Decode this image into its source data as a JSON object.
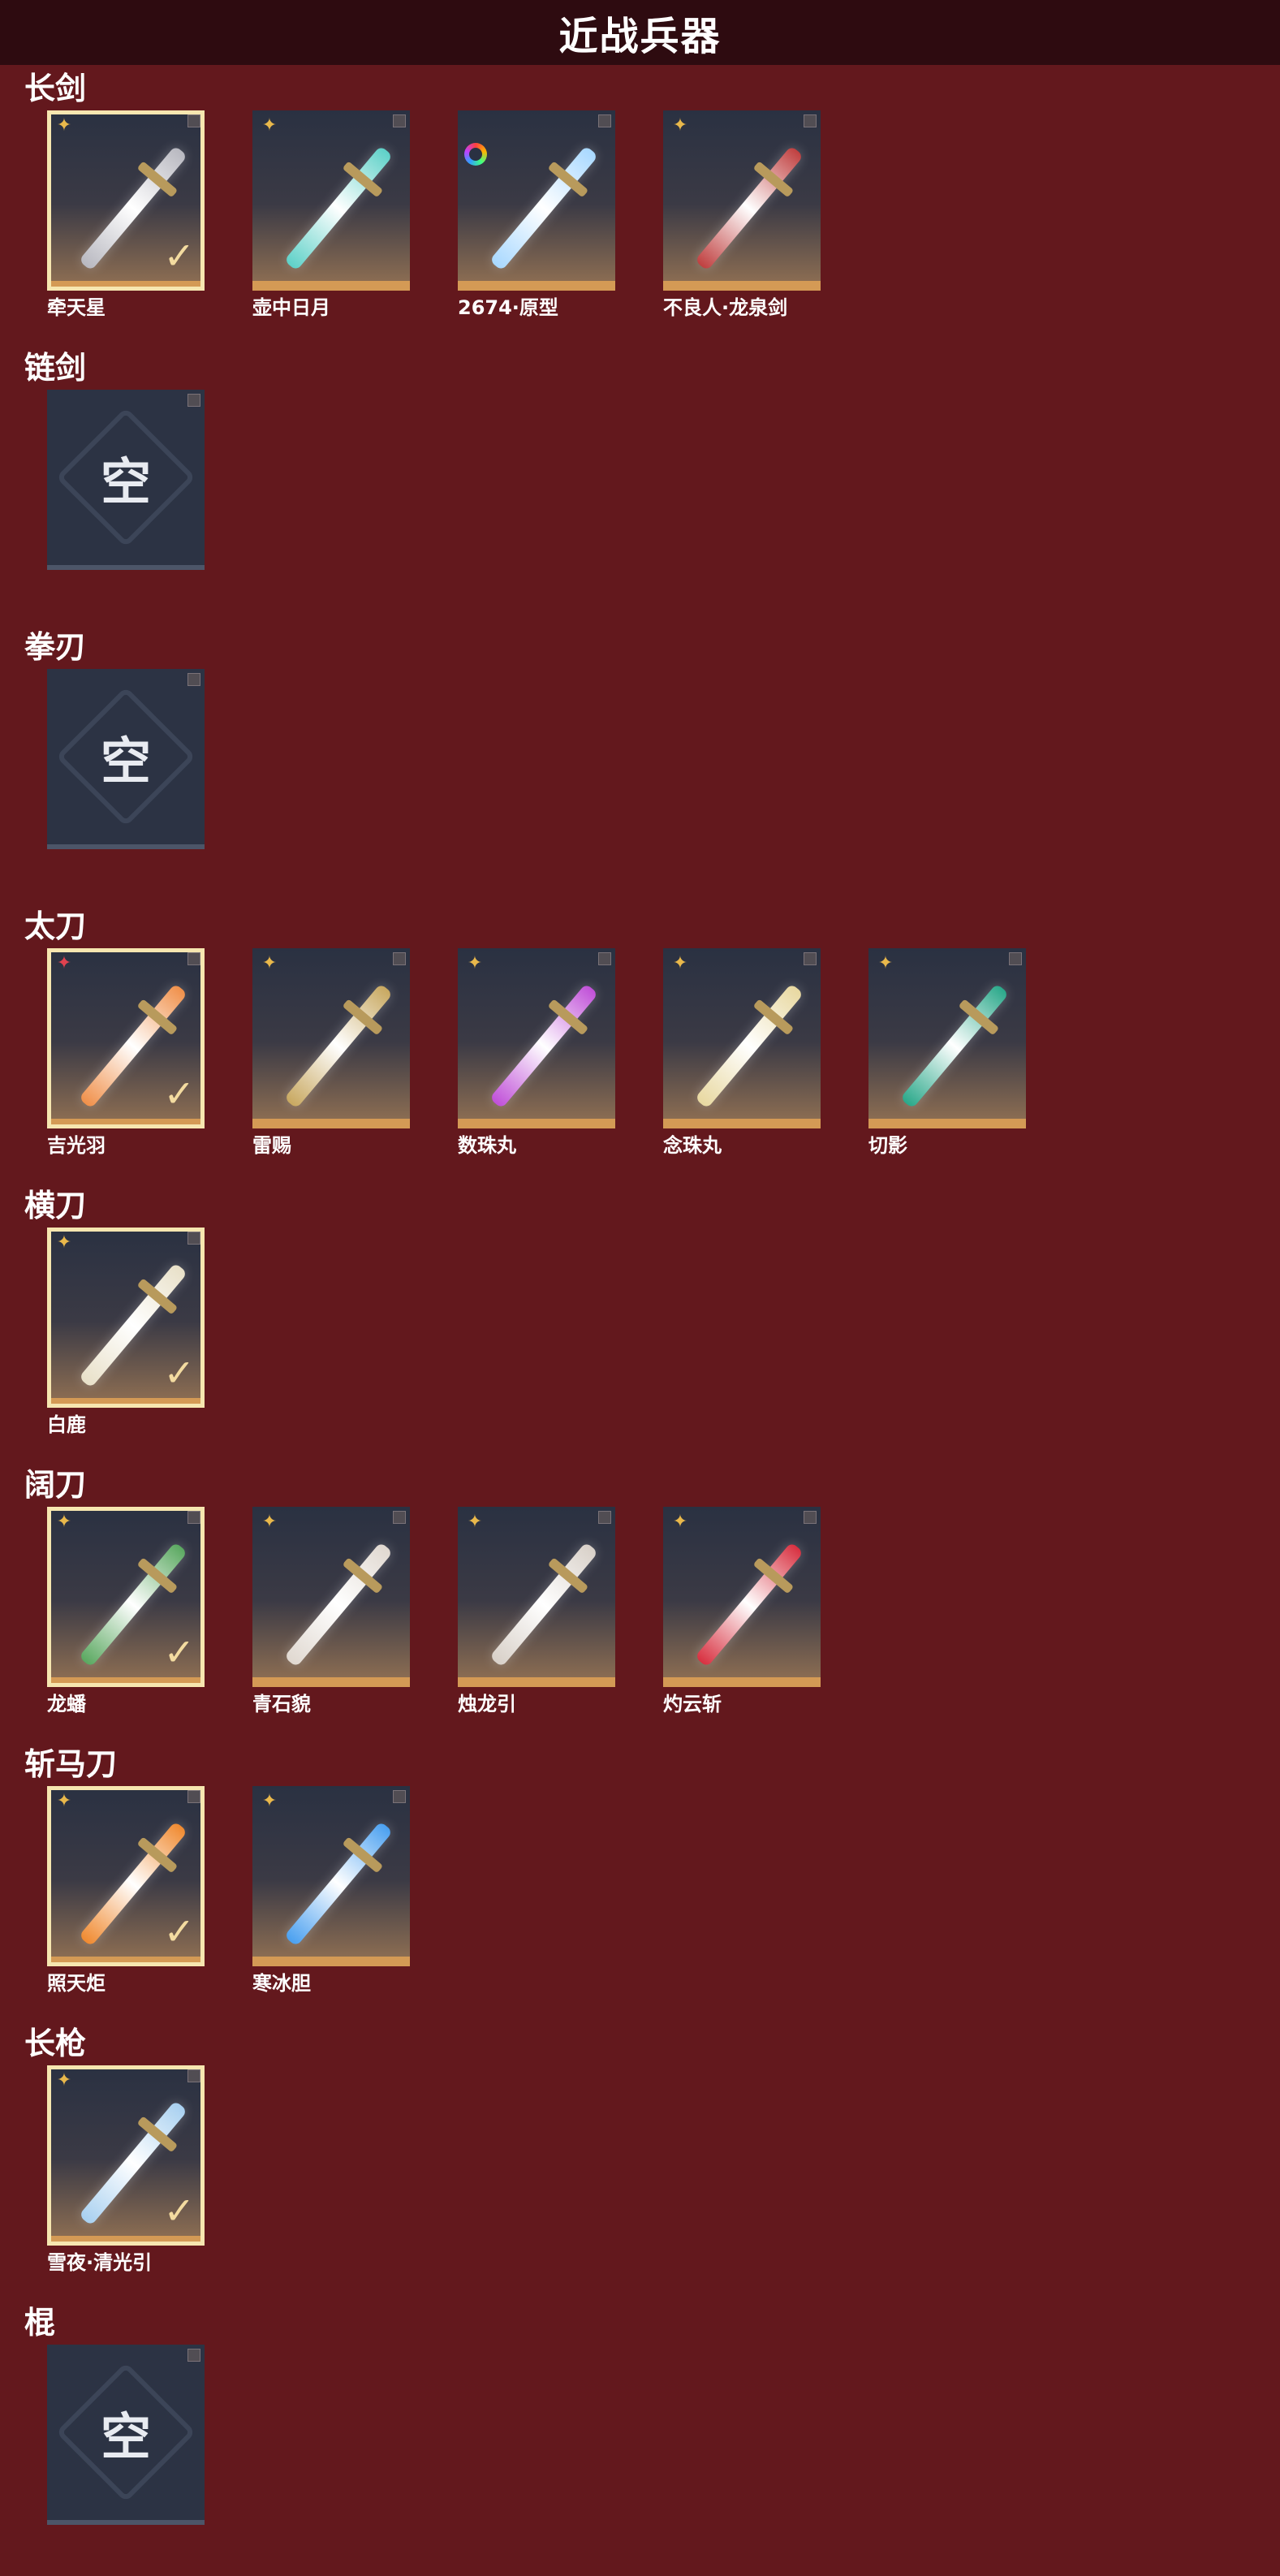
{
  "page": {
    "title": "近战兵器"
  },
  "empty_label": "空",
  "colors": {
    "background": "#63181d",
    "header": "#2e0b10",
    "card_border": "#d49a55",
    "selected_outline": "#f6e6b0"
  },
  "categories": [
    {
      "title": "长剑",
      "items": [
        {
          "name": "牵天星",
          "rarity": "gold-star-icon",
          "selected": true,
          "color": "#b8b8c0"
        },
        {
          "name": "壶中日月",
          "rarity": "gold-star-icon",
          "selected": false,
          "color": "#5ed1c8"
        },
        {
          "name": "2674·原型",
          "rarity": "rainbow-ring-icon",
          "selected": false,
          "color": "#a8d8ff"
        },
        {
          "name": "不良人·龙泉剑",
          "rarity": "gold-star-icon",
          "selected": false,
          "color": "#c04040"
        }
      ]
    },
    {
      "title": "链剑",
      "items": [
        {
          "name": "",
          "empty": true
        }
      ]
    },
    {
      "title": "拳刃",
      "items": [
        {
          "name": "",
          "empty": true
        }
      ]
    },
    {
      "title": "太刀",
      "items": [
        {
          "name": "吉光羽",
          "rarity": "red-star-icon",
          "selected": true,
          "color": "#f0904a"
        },
        {
          "name": "雷赐",
          "rarity": "gold-star-icon",
          "selected": false,
          "color": "#c8a860"
        },
        {
          "name": "数珠丸",
          "rarity": "gold-star-icon",
          "selected": false,
          "color": "#c050d8"
        },
        {
          "name": "念珠丸",
          "rarity": "gold-star-icon",
          "selected": false,
          "color": "#e8d8a0"
        },
        {
          "name": "切影",
          "rarity": "gold-star-icon",
          "selected": false,
          "color": "#2aa88a"
        }
      ]
    },
    {
      "title": "横刀",
      "items": [
        {
          "name": "白鹿",
          "rarity": "gold-star-icon",
          "selected": true,
          "color": "#e8e0c8"
        }
      ]
    },
    {
      "title": "阔刀",
      "items": [
        {
          "name": "龙蟠",
          "rarity": "gold-star-icon",
          "selected": true,
          "color": "#5aa860"
        },
        {
          "name": "青石貌",
          "rarity": "gold-star-icon",
          "selected": false,
          "color": "#e0d8d0"
        },
        {
          "name": "烛龙引",
          "rarity": "gold-star-icon",
          "selected": false,
          "color": "#d8d0c8"
        },
        {
          "name": "灼云斩",
          "rarity": "gold-star-icon",
          "selected": false,
          "color": "#d83040"
        }
      ]
    },
    {
      "title": "斩马刀",
      "items": [
        {
          "name": "照天炬",
          "rarity": "gold-star-icon",
          "selected": true,
          "color": "#f08a30"
        },
        {
          "name": "寒冰胆",
          "rarity": "gold-star-icon",
          "selected": false,
          "color": "#4aa0f0"
        }
      ]
    },
    {
      "title": "长枪",
      "items": [
        {
          "name": "雪夜·清光引",
          "rarity": "gold-star-icon",
          "selected": true,
          "color": "#a8d0f0"
        }
      ]
    },
    {
      "title": "棍",
      "items": [
        {
          "name": "",
          "empty": true
        }
      ]
    }
  ]
}
